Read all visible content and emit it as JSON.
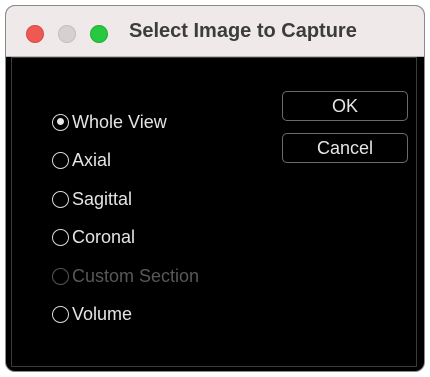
{
  "window": {
    "title": "Select Image to Capture"
  },
  "options": [
    {
      "label": "Whole View",
      "checked": true,
      "enabled": true
    },
    {
      "label": "Axial",
      "checked": false,
      "enabled": true
    },
    {
      "label": "Sagittal",
      "checked": false,
      "enabled": true
    },
    {
      "label": "Coronal",
      "checked": false,
      "enabled": true
    },
    {
      "label": "Custom Section",
      "checked": false,
      "enabled": false
    },
    {
      "label": "Volume",
      "checked": false,
      "enabled": true
    }
  ],
  "buttons": {
    "ok_label": "OK",
    "cancel_label": "Cancel"
  },
  "colors": {
    "close": "#ee5a52",
    "minimize": "#d6d1d1",
    "zoom": "#28c941",
    "background": "#000000",
    "titlebar": "#efe9e9"
  }
}
